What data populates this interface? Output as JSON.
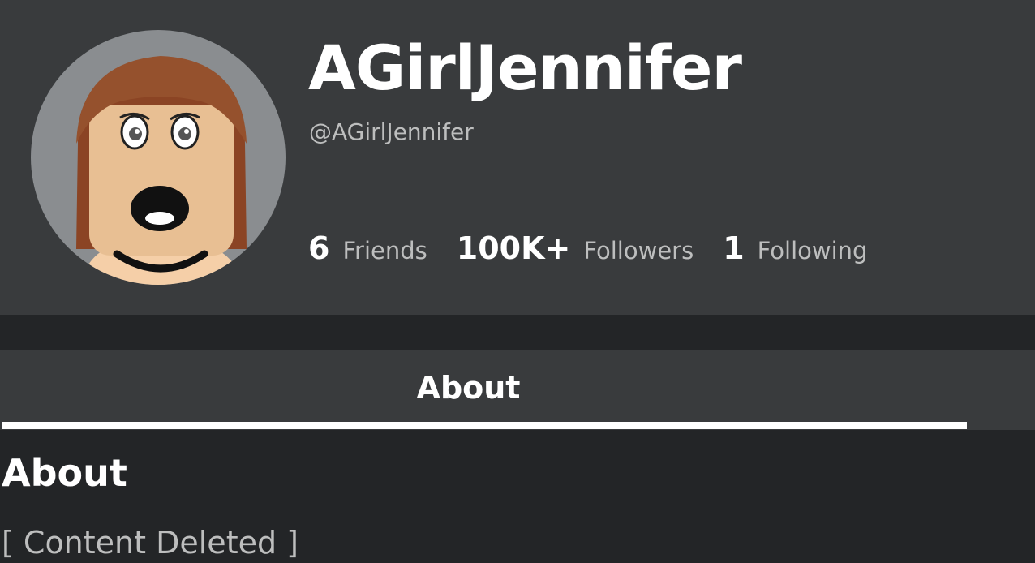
{
  "profile": {
    "display_name": "AGirlJennifer",
    "username": "@AGirlJennifer",
    "avatar_icon": "avatar-headshot-icon"
  },
  "stats": [
    {
      "count": "6",
      "label": "Friends"
    },
    {
      "count": "100K+",
      "label": "Followers"
    },
    {
      "count": "1",
      "label": "Following"
    }
  ],
  "tabs": [
    {
      "label": "About",
      "active": true
    }
  ],
  "about": {
    "title": "About",
    "body": "[ Content Deleted ]"
  },
  "colors": {
    "page_bg": "#232527",
    "card_bg": "#393b3d",
    "text_primary": "#ffffff",
    "text_secondary": "#bdbebe"
  }
}
